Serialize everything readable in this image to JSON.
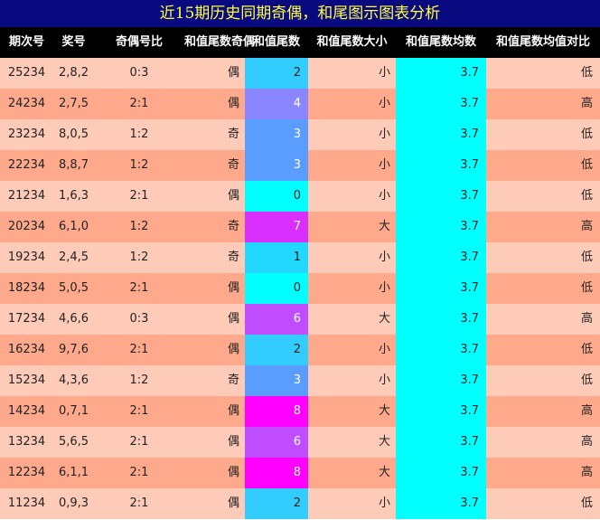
{
  "title": "近15期历史同期奇偶，和尾图示图表分析",
  "headers": [
    "期次号",
    "奖号",
    "奇偶号比",
    "和值尾数奇偶",
    "和值尾数",
    "和值尾数大小",
    "和值尾数均数",
    "和值尾数均值对比"
  ],
  "colors": {
    "row_even": "#ffcbb9",
    "row_odd": "#ffa98c",
    "mean_column": "#00ffff",
    "tail_0": "#00ffff",
    "tail_1": "#22d8ff",
    "tail_2": "#33ccff",
    "tail_3": "#5b9cff",
    "tail_4": "#8a86ff",
    "tail_6": "#c04dff",
    "tail_7": "#d930ff",
    "tail_8": "#ff00ff"
  },
  "rows": [
    {
      "period": "25234",
      "numbers": "2,8,2",
      "ratio": "0:3",
      "parity": "偶",
      "tail": "2",
      "size": "小",
      "mean": "3.7",
      "compare": "低"
    },
    {
      "period": "24234",
      "numbers": "2,7,5",
      "ratio": "2:1",
      "parity": "偶",
      "tail": "4",
      "size": "小",
      "mean": "3.7",
      "compare": "高"
    },
    {
      "period": "23234",
      "numbers": "8,0,5",
      "ratio": "1:2",
      "parity": "奇",
      "tail": "3",
      "size": "小",
      "mean": "3.7",
      "compare": "低"
    },
    {
      "period": "22234",
      "numbers": "8,8,7",
      "ratio": "1:2",
      "parity": "奇",
      "tail": "3",
      "size": "小",
      "mean": "3.7",
      "compare": "低"
    },
    {
      "period": "21234",
      "numbers": "1,6,3",
      "ratio": "2:1",
      "parity": "偶",
      "tail": "0",
      "size": "小",
      "mean": "3.7",
      "compare": "低"
    },
    {
      "period": "20234",
      "numbers": "6,1,0",
      "ratio": "1:2",
      "parity": "奇",
      "tail": "7",
      "size": "大",
      "mean": "3.7",
      "compare": "高"
    },
    {
      "period": "19234",
      "numbers": "2,4,5",
      "ratio": "1:2",
      "parity": "奇",
      "tail": "1",
      "size": "小",
      "mean": "3.7",
      "compare": "低"
    },
    {
      "period": "18234",
      "numbers": "5,0,5",
      "ratio": "2:1",
      "parity": "偶",
      "tail": "0",
      "size": "小",
      "mean": "3.7",
      "compare": "低"
    },
    {
      "period": "17234",
      "numbers": "4,6,6",
      "ratio": "0:3",
      "parity": "偶",
      "tail": "6",
      "size": "大",
      "mean": "3.7",
      "compare": "高"
    },
    {
      "period": "16234",
      "numbers": "9,7,6",
      "ratio": "2:1",
      "parity": "偶",
      "tail": "2",
      "size": "小",
      "mean": "3.7",
      "compare": "低"
    },
    {
      "period": "15234",
      "numbers": "4,3,6",
      "ratio": "1:2",
      "parity": "奇",
      "tail": "3",
      "size": "小",
      "mean": "3.7",
      "compare": "低"
    },
    {
      "period": "14234",
      "numbers": "0,7,1",
      "ratio": "2:1",
      "parity": "偶",
      "tail": "8",
      "size": "大",
      "mean": "3.7",
      "compare": "高"
    },
    {
      "period": "13234",
      "numbers": "5,6,5",
      "ratio": "2:1",
      "parity": "偶",
      "tail": "6",
      "size": "大",
      "mean": "3.7",
      "compare": "高"
    },
    {
      "period": "12234",
      "numbers": "6,1,1",
      "ratio": "2:1",
      "parity": "偶",
      "tail": "8",
      "size": "大",
      "mean": "3.7",
      "compare": "高"
    },
    {
      "period": "11234",
      "numbers": "0,9,3",
      "ratio": "2:1",
      "parity": "偶",
      "tail": "2",
      "size": "小",
      "mean": "3.7",
      "compare": "低"
    }
  ]
}
